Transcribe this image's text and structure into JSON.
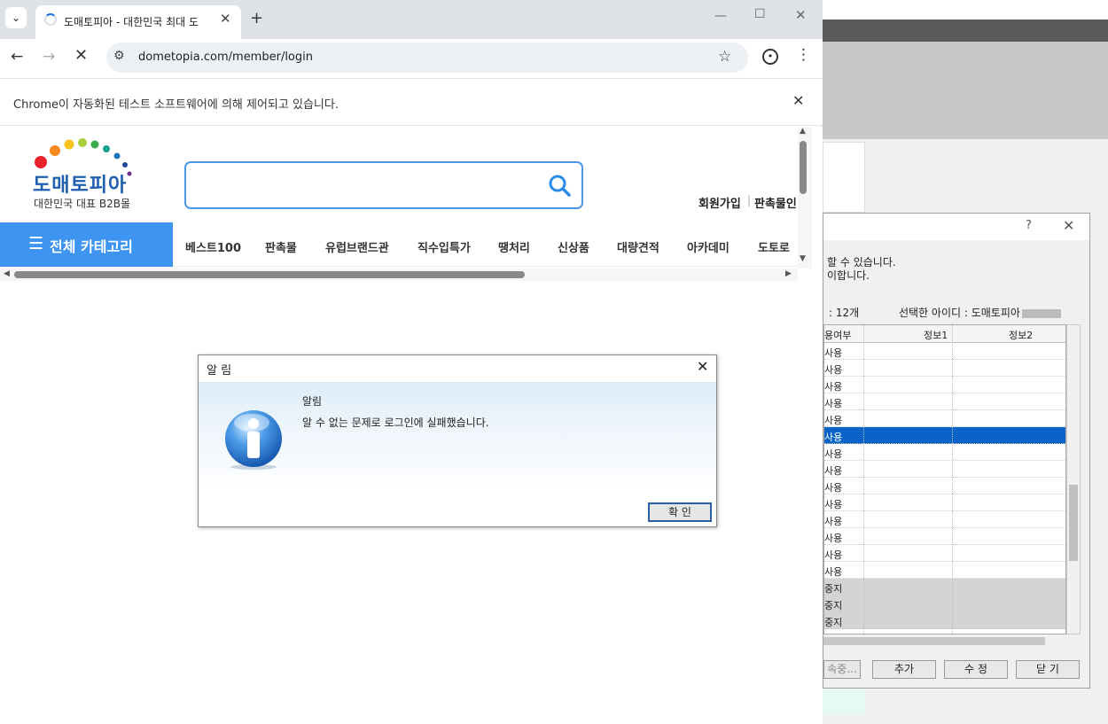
{
  "browser": {
    "tab_title": "도매토피아 - 대한민국 최대 도",
    "url": "dometopia.com/member/login",
    "automation_notice": "Chrome이 자동화된 테스트 소프트웨어에 의해 제어되고 있습니다."
  },
  "site": {
    "logo_text": "도매토피아",
    "logo_sub": "대한민국 대표 B2B몰",
    "links": {
      "join": "회원가입",
      "sep": "|",
      "seller": "판촉물인"
    },
    "category_button": "전체 카테고리",
    "nav": [
      "베스트100",
      "판촉물",
      "유럽브랜드관",
      "직수입특가",
      "땡처리",
      "신상품",
      "대량견적",
      "아카데미",
      "도토로"
    ]
  },
  "alert": {
    "title": "알 림",
    "heading": "알림",
    "message": "알 수 없는 문제로 로그인에 실패했습니다.",
    "ok": "확 인"
  },
  "bg_dialog": {
    "help": "?",
    "line1": "할 수 있습니다.",
    "line2": "이합니다.",
    "count": ": 12개",
    "selected_label": "선택한 아이디 : 도매토피아",
    "col_status": "용여부",
    "col_info1": "정보1",
    "col_info2": "정보2",
    "rows": [
      "사용",
      "사용",
      "사용",
      "사용",
      "사용",
      "사용",
      "사용",
      "사용",
      "사용",
      "사용",
      "사용",
      "사용",
      "사용",
      "사용",
      "중지",
      "중지",
      "중지"
    ],
    "buttons": {
      "connect": "속중...",
      "add": "추가",
      "edit": "수 정",
      "close": "닫 기"
    }
  },
  "colors": {
    "accent": "#3d94f1",
    "logo": "#1f5fb0",
    "selection": "#0a64c8"
  }
}
